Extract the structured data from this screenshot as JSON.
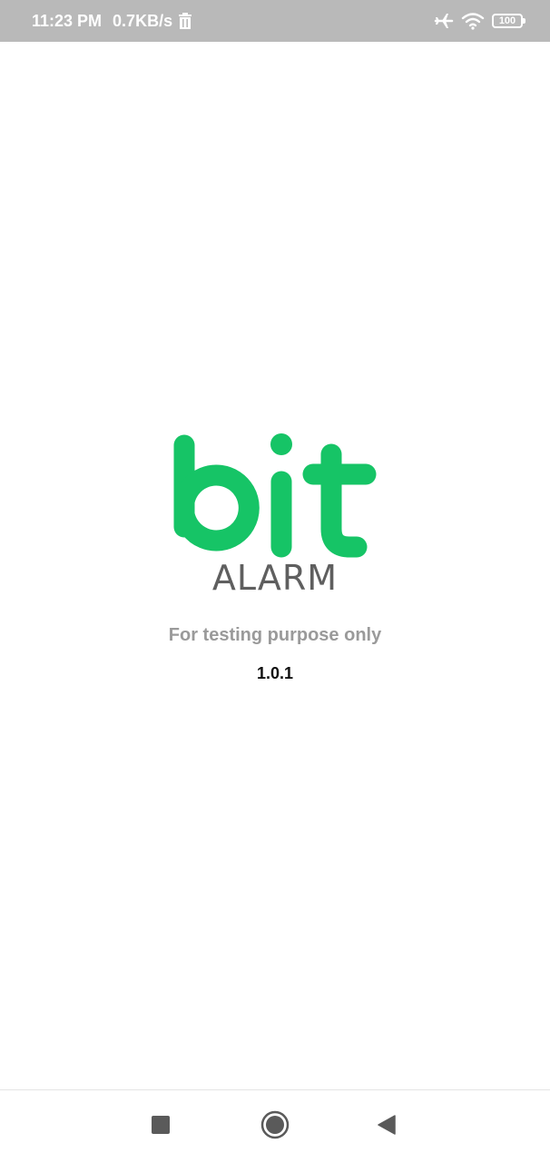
{
  "status_bar": {
    "time": "11:23 PM",
    "net_speed": "0.7KB/s",
    "battery_level": "100",
    "icons": [
      "trash-icon",
      "airplane-icon",
      "wifi-icon",
      "battery-icon"
    ]
  },
  "logo": {
    "bit": "bit",
    "alarm": "ALARM",
    "brand_color": "#16c466"
  },
  "tagline": "For testing purpose only",
  "version": "1.0.1",
  "nav_bar": {
    "buttons": [
      "recent-apps-icon",
      "home-icon",
      "back-icon"
    ]
  }
}
